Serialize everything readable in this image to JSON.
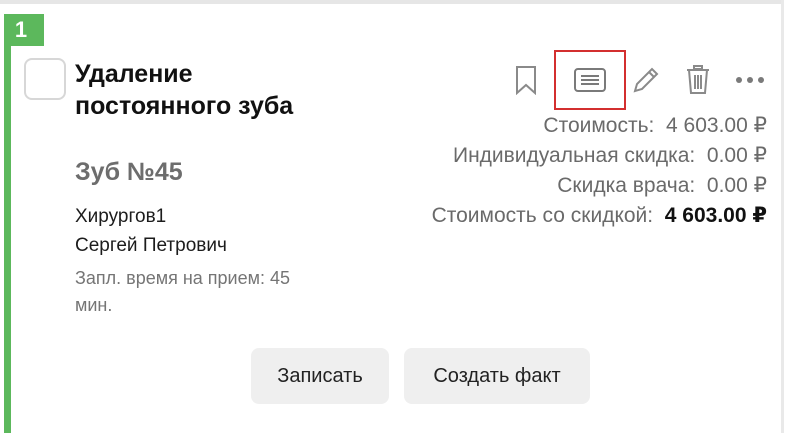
{
  "card": {
    "index": "1",
    "title": "Удаление постоянного зуба",
    "tooth": "Зуб №45",
    "doctor_line1": "Хирургов1",
    "doctor_line2": "Сергей Петрович",
    "planned_time": "Запл. время на прием: 45 мин.",
    "accent_color": "#5cb85c"
  },
  "toolbar": {
    "icons": [
      "bookmark-icon",
      "list-icon",
      "pencil-icon",
      "trash-icon",
      "more-icon"
    ],
    "highlight_color": "#d32f2f"
  },
  "prices": {
    "cost_label": "Стоимость:",
    "cost_value": "4 603.00 ₽",
    "individual_discount_label": "Индивидуальная скидка:",
    "individual_discount_value": "0.00 ₽",
    "doctor_discount_label": "Скидка врача:",
    "doctor_discount_value": "0.00 ₽",
    "discounted_cost_label": "Стоимость со скидкой:",
    "discounted_cost_value": "4 603.00 ₽"
  },
  "actions": {
    "record_label": "Записать",
    "create_fact_label": "Создать факт"
  }
}
